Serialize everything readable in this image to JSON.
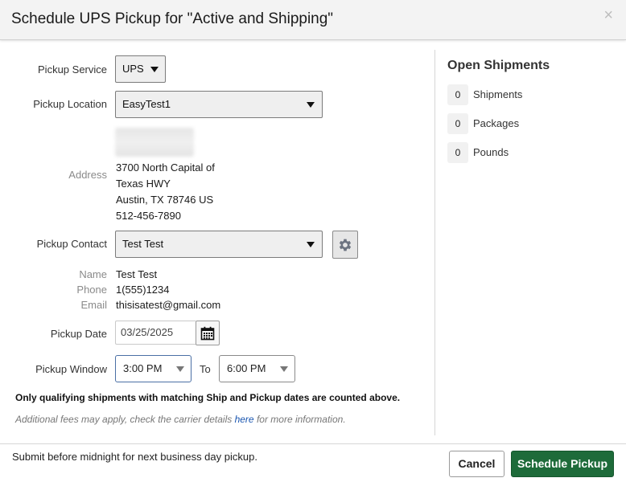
{
  "dialog": {
    "title": "Schedule UPS Pickup for \"Active and Shipping\"",
    "close_label": "×"
  },
  "form": {
    "pickup_service": {
      "label": "Pickup Service",
      "value": "UPS"
    },
    "pickup_location": {
      "label": "Pickup Location",
      "value": "EasyTest1"
    },
    "address": {
      "label": "Address",
      "lines": [
        "3700 North Capital of",
        "Texas HWY",
        "Austin, TX 78746 US",
        "512-456-7890"
      ]
    },
    "pickup_contact": {
      "label": "Pickup Contact",
      "value": "Test Test"
    },
    "contact_details": {
      "name_label": "Name",
      "name": "Test Test",
      "phone_label": "Phone",
      "phone": "1(555)1234",
      "email_label": "Email",
      "email": "thisisatest@gmail.com"
    },
    "pickup_date": {
      "label": "Pickup Date",
      "value": "03/25/2025"
    },
    "pickup_window": {
      "label": "Pickup Window",
      "from": "3:00 PM",
      "to_label": "To",
      "to": "6:00 PM"
    },
    "qualifying_note": "Only qualifying shipments with matching Ship and Pickup dates are counted above.",
    "fee_note": {
      "prefix": "Additional fees may apply, check the carrier details ",
      "link": "here",
      "suffix": " for more information."
    }
  },
  "open_shipments": {
    "title": "Open Shipments",
    "items": [
      {
        "count": "0",
        "label": "Shipments"
      },
      {
        "count": "0",
        "label": "Packages"
      },
      {
        "count": "0",
        "label": "Pounds"
      }
    ]
  },
  "footer": {
    "note": "Submit before midnight for next business day pickup.",
    "cancel_label": "Cancel",
    "submit_label": "Schedule Pickup"
  },
  "colors": {
    "primary_button": "#1e6b3a",
    "link": "#1a56b0",
    "header_bg": "#f3f3f3"
  },
  "icons": {
    "settings": "gear-icon",
    "calendar": "calendar-icon",
    "close": "close-icon",
    "dropdown": "caret-down-icon"
  }
}
